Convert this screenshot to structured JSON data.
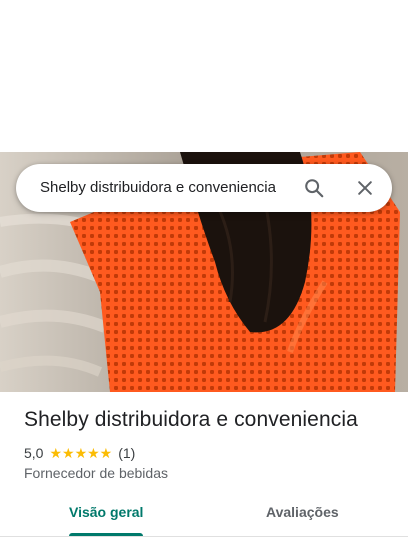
{
  "search": {
    "query": "Shelby distribuidora e conveniencia",
    "search_icon": "search-icon",
    "close_icon": "close-icon"
  },
  "hero": {
    "image": "place-photo"
  },
  "place": {
    "name": "Shelby distribuidora e conveniencia",
    "rating": "5,0",
    "stars": "★★★★★",
    "star_value": 5,
    "review_count": "(1)",
    "category": "Fornecedor de bebidas"
  },
  "tabs": [
    {
      "label": "Visão geral",
      "selected": true
    },
    {
      "label": "Avaliações",
      "selected": false
    }
  ],
  "colors": {
    "accent": "#00796b",
    "star": "#fbbc04",
    "text_primary": "#202124",
    "text_secondary": "#5f6368"
  }
}
